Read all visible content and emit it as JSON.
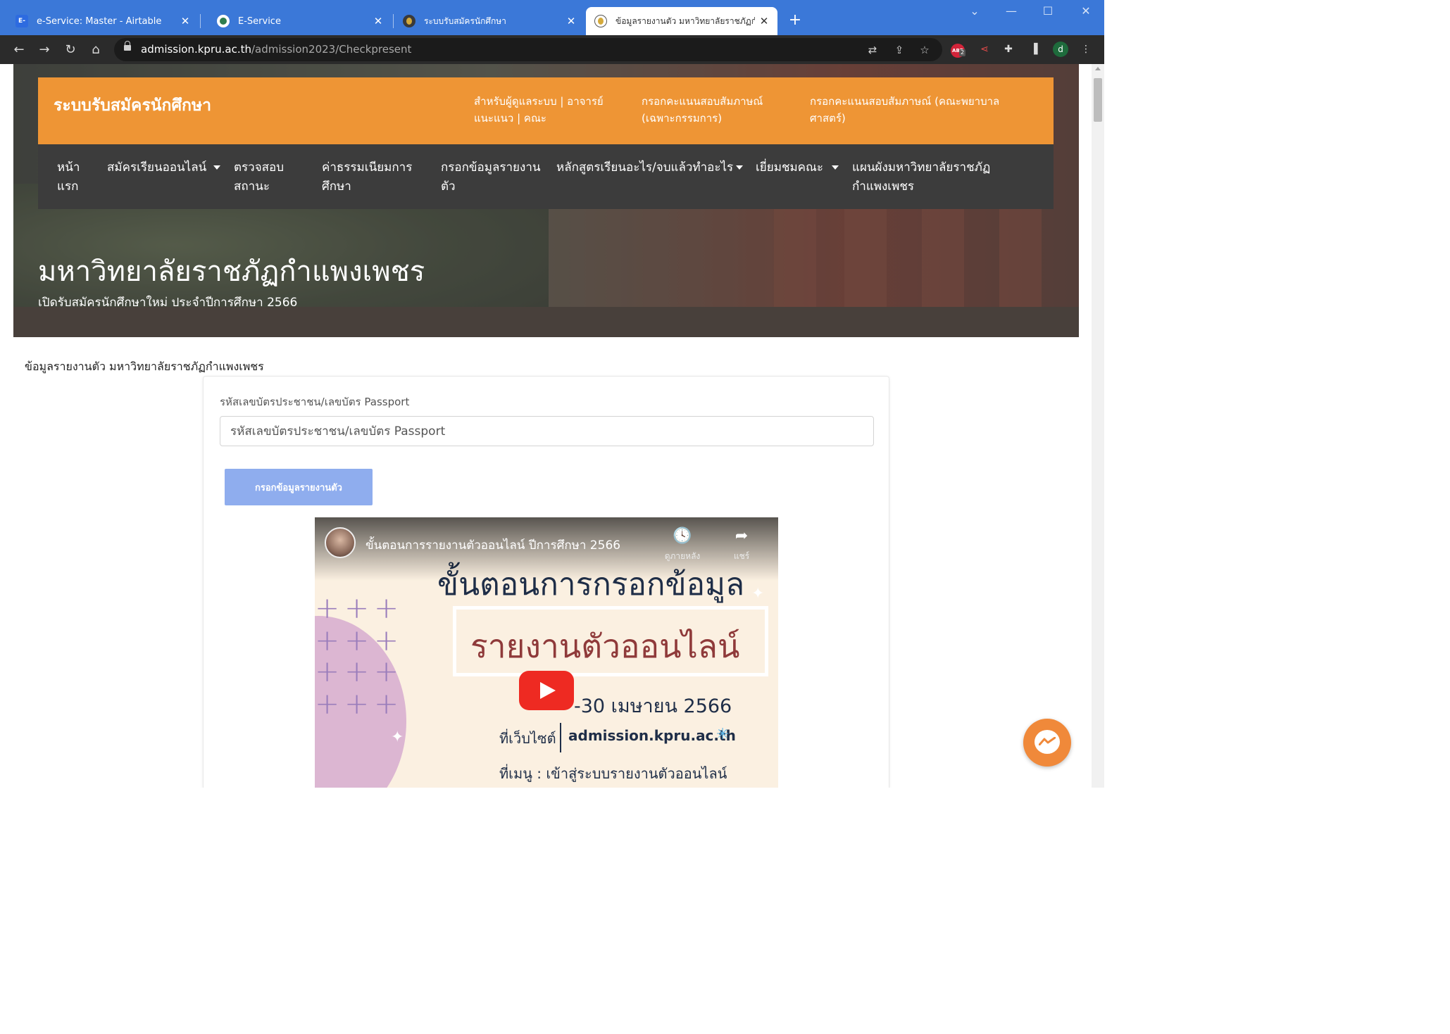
{
  "browser": {
    "tabs": [
      {
        "title": "e-Service: Master - Airtable",
        "favicon": "E-"
      },
      {
        "title": "E-Service",
        "favicon": ""
      },
      {
        "title": "ระบบรับสมัครนักศึกษา",
        "favicon": ""
      },
      {
        "title": "ข้อมูลรายงานตัว มหาวิทยาลัยราชภัฏกำ",
        "favicon": ""
      }
    ],
    "url_host": "admission.kpru.ac.th",
    "url_path": "/admission2023/Checkpresent",
    "profile_initial": "d",
    "adblock_badge": "2",
    "adblock_label": "ABP"
  },
  "site": {
    "brand": "ระบบรับสมัครนักศึกษา",
    "top_links": [
      "สำหรับผู้ดูแลระบบ | อาจารย์แนะแนว | คณะ",
      "กรอกคะแนนสอบสัมภาษณ์ (เฉพาะกรรมการ)",
      "กรอกคะแนนสอบสัมภาษณ์ (คณะพยาบาลศาสตร์)"
    ],
    "nav": [
      {
        "label": "หน้าแรก",
        "dropdown": false
      },
      {
        "label": "สมัครเรียนออนไลน์",
        "dropdown": true
      },
      {
        "label": "ตรวจสอบสถานะ",
        "dropdown": false
      },
      {
        "label": "ค่าธรรมเนียมการศึกษา",
        "dropdown": false
      },
      {
        "label": "กรอกข้อมูลรายงานตัว",
        "dropdown": false
      },
      {
        "label": "หลักสูตรเรียนอะไร/จบแล้วทำอะไร",
        "dropdown": true
      },
      {
        "label": "เยี่ยมชมคณะ",
        "dropdown": true
      },
      {
        "label": "แผนผังมหาวิทยาลัยราชภัฏกำแพงเพชร",
        "dropdown": false
      }
    ],
    "hero_title": "มหาวิทยาลัยราชภัฏกำแพงเพชร",
    "hero_subtitle": "เปิดรับสมัครนักศึกษาใหม่ ประจำปีการศึกษา 2566"
  },
  "main": {
    "heading": "ข้อมูลรายงานตัว มหาวิทยาลัยราชภัฏกำแพงเพชร",
    "form": {
      "label": "รหัสเลขบัตรประชาชน/เลขบัตร Passport",
      "placeholder": "รหัสเลขบัตรประชาชน/เลขบัตร Passport",
      "value": "",
      "submit_label": "กรอกข้อมูลรายงานตัว"
    },
    "video": {
      "title": "ขั้นตอนการรายงานตัวออนไลน์ ปีการศึกษา 2566",
      "watch_later": "ดูภายหลัง",
      "share": "แชร์",
      "headline": "ขั้นตอนการกรอกข้อมูล",
      "boxed_text": "รายงานตัวออนไลน์",
      "date_text": "-30 เมษายน 2566",
      "site_prefix": "ที่เว็บไซต์",
      "site": "admission.kpru.ac.th",
      "menu_text": "ที่เมนู : เข้าสู่ระบบรายงานตัวออนไลน์"
    }
  },
  "colors": {
    "tabstrip": "#3b78d8",
    "site_orange": "#ee9535",
    "nav_dark": "#3c3c3c",
    "submit_button": "#8fadee",
    "messenger": "#f0893a",
    "youtube_red": "#ee2a22"
  },
  "icons": {
    "messenger": "messenger-icon",
    "play": "youtube-play-icon"
  }
}
